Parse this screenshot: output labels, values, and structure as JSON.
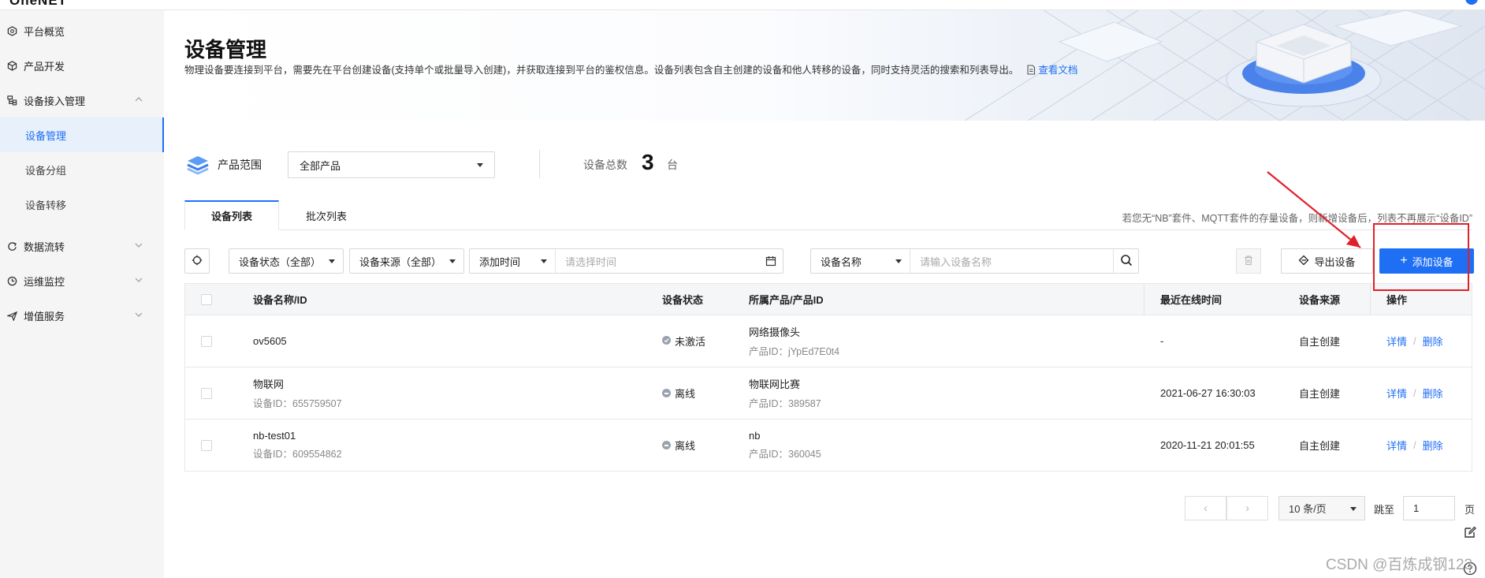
{
  "topbar": {
    "logo": "OneNET"
  },
  "sidebar": {
    "items": [
      {
        "label": "平台概览",
        "icon": "hexagon-icon"
      },
      {
        "label": "产品开发",
        "icon": "cube-icon"
      },
      {
        "label": "设备接入管理",
        "icon": "device-tree-icon",
        "expanded": true
      },
      {
        "label": "设备管理",
        "active": true
      },
      {
        "label": "设备分组"
      },
      {
        "label": "设备转移"
      },
      {
        "label": "数据流转",
        "icon": "data-flow-icon",
        "expanded": false
      },
      {
        "label": "运维监控",
        "icon": "clock-monitor-icon",
        "expanded": false
      },
      {
        "label": "增值服务",
        "icon": "send-icon",
        "expanded": false
      }
    ]
  },
  "header": {
    "title": "设备管理",
    "description": "物理设备要连接到平台，需要先在平台创建设备(支持单个或批量导入创建)，并获取连接到平台的鉴权信息。设备列表包含自主创建的设备和他人转移的设备，同时支持灵活的搜索和列表导出。",
    "doc_link": "查看文档"
  },
  "range": {
    "label": "产品范围",
    "value": "全部产品",
    "total_label": "设备总数",
    "total": "3",
    "unit": "台"
  },
  "tabs": [
    {
      "label": "设备列表",
      "active": true
    },
    {
      "label": "批次列表",
      "active": false
    }
  ],
  "tab_note": "若您无“NB”套件、MQTT套件的存量设备，则新增设备后，列表不再展示“设备ID”",
  "filters": {
    "status": "设备状态（全部）",
    "source": "设备来源（全部）",
    "time": "添加时间",
    "time_placeholder": "请选择时间",
    "field": "设备名称",
    "search_placeholder": "请输入设备名称"
  },
  "actions": {
    "export": "导出设备",
    "add": "添加设备"
  },
  "table": {
    "headers": [
      "设备名称/ID",
      "设备状态",
      "所属产品/产品ID",
      "最近在线时间",
      "设备来源",
      "操作"
    ],
    "rows": [
      {
        "name": "ov5605",
        "id": "",
        "status": "未激活",
        "product": "网络摄像头",
        "product_id": "产品ID：jYpEd7E0t4",
        "last_online": "-",
        "source": "自主创建",
        "detail": "详情",
        "sep": "/",
        "delete": "删除"
      },
      {
        "name": "物联网",
        "id": "设备ID：655759507",
        "status": "离线",
        "product": "物联网比赛",
        "product_id": "产品ID：389587",
        "last_online": "2021-06-27 16:30:03",
        "source": "自主创建",
        "detail": "详情",
        "sep": "/",
        "delete": "删除"
      },
      {
        "name": "nb-test01",
        "id": "设备ID：609554862",
        "status": "离线",
        "product": "nb",
        "product_id": "产品ID：360045",
        "last_online": "2020-11-21 20:01:55",
        "source": "自主创建",
        "detail": "详情",
        "sep": "/",
        "delete": "删除"
      }
    ]
  },
  "pagination": {
    "prev": "‹",
    "next": "›",
    "page_size": "10 条/页",
    "jump_label": "跳至",
    "jump_value": "1",
    "page_unit": "页"
  },
  "watermark": "CSDN @百炼成钢123",
  "colors": {
    "primary": "#1f6ff5",
    "annotation": "#e0202a",
    "sidebar_bg": "#f5f5f5"
  }
}
